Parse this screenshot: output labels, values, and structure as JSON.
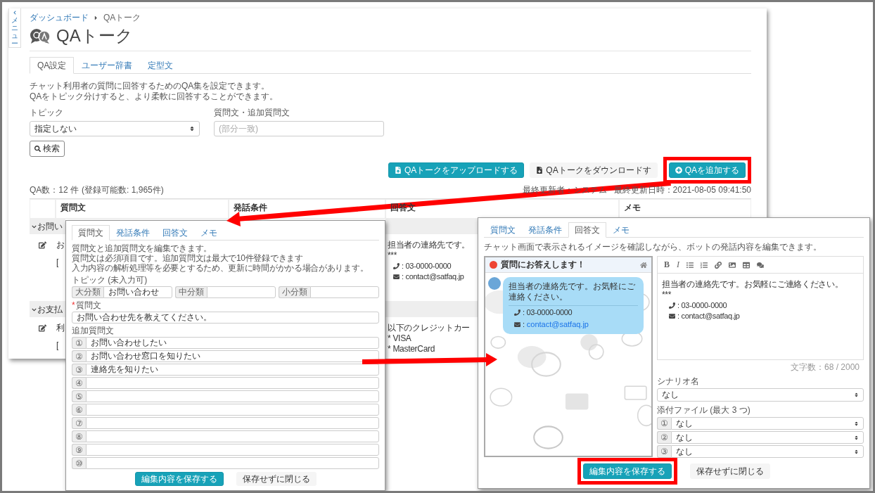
{
  "side_menu": {
    "label": "メニュー"
  },
  "breadcrumb": [
    "ダッシュボード",
    "QAトーク"
  ],
  "page_title": "QAトーク",
  "tabs": [
    {
      "label": "QA設定",
      "selected": true
    },
    {
      "label": "ユーザー辞書",
      "selected": false
    },
    {
      "label": "定型文",
      "selected": false
    }
  ],
  "description": [
    "チャット利用者の質問に回答するためのQA集を設定できます。",
    "QAをトピック分けすると、より柔軟に回答することができます。"
  ],
  "filters": {
    "topic": {
      "label": "トピック",
      "value": "指定しない"
    },
    "query": {
      "label": "質問文・追加質問文",
      "placeholder": "(部分一致)"
    },
    "search_button": "検索"
  },
  "actions": [
    {
      "kind": "upload",
      "label": "QAトークをアップロードする",
      "highlighted": false
    },
    {
      "kind": "download",
      "label": "QAトークをダウンロードす",
      "highlighted": false
    },
    {
      "kind": "add",
      "label": "QAを追加する",
      "highlighted": true
    }
  ],
  "summary": {
    "count": "QA数：12 件",
    "capacity": "(登録可能数: 1,965件)",
    "updated_by": "最終更新者：システム",
    "updated_at": "最終更新日時：2021-08-05 09:41:50"
  },
  "table": {
    "columns": [
      "質問文",
      "発話条件",
      "回答文",
      "メモ"
    ],
    "groups": [
      {
        "label": "お問い",
        "expanded": true,
        "rows": [
          {
            "question": [
              "お",
              "["
            ],
            "answer": [
              {
                "kind": "text",
                "text": "担当者の連絡先です。"
              },
              {
                "kind": "text",
                "text": "***"
              },
              {
                "kind": "phone",
                "label": ":",
                "text": "03-0000-0000",
                "link": false
              },
              {
                "kind": "email",
                "label": ":",
                "text": "contact@satfaq.jp",
                "link": false
              }
            ]
          }
        ]
      },
      {
        "label": "お支払",
        "expanded": true,
        "rows": [
          {
            "question": [
              "利",
              "["
            ],
            "answer": [
              {
                "kind": "text",
                "text": "以下のクレジットカー"
              },
              {
                "kind": "text",
                "text": "* VISA"
              },
              {
                "kind": "text",
                "text": "* MasterCard"
              }
            ]
          }
        ]
      }
    ]
  },
  "question_editor": {
    "tabs": [
      {
        "label": "質問文",
        "selected": true
      },
      {
        "label": "発話条件",
        "selected": false
      },
      {
        "label": "回答文",
        "selected": false
      },
      {
        "label": "メモ",
        "selected": false
      }
    ],
    "description": [
      "質問文と追加質問文を編集できます。",
      "質問文は必須項目です。追加質問文は最大で10件登録できます",
      "入力内容の解析処理等を必要とするため、更新に時間がかかる場合があります。"
    ],
    "topic_label": "トピック (未入力可)",
    "topic_fields": [
      {
        "label": "大分類",
        "value": "お問い合わせ"
      },
      {
        "label": "中分類"
      },
      {
        "label": "小分類"
      }
    ],
    "required_mark": "*",
    "question_label": "質問文",
    "question": "お問い合わせ先を教えてください。",
    "extra_label": "追加質問文",
    "extra_questions": [
      {
        "number": "①",
        "value": "お問い合わせしたい"
      },
      {
        "number": "②",
        "value": "お問い合わせ窓口を知りたい"
      },
      {
        "number": "③",
        "value": "連絡先を知りたい"
      },
      {
        "number": "④"
      },
      {
        "number": "⑤"
      },
      {
        "number": "⑥"
      },
      {
        "number": "⑦"
      },
      {
        "number": "⑧"
      },
      {
        "number": "⑨"
      },
      {
        "number": "⑩"
      }
    ],
    "buttons": [
      {
        "kind": "primary",
        "label": "編集内容を保存する",
        "highlighted": false
      },
      {
        "kind": "plain",
        "label": "保存せずに閉じる",
        "highlighted": false
      }
    ]
  },
  "answer_editor": {
    "tabs": [
      {
        "label": "質問文",
        "selected": false
      },
      {
        "label": "発話条件",
        "selected": false
      },
      {
        "label": "回答文",
        "selected": true
      },
      {
        "label": "メモ",
        "selected": false
      }
    ],
    "description": "チャット画面で表示されるイメージを確認しながら、ボットの発話内容を編集できます。",
    "preview": {
      "title": "質問にお答えします！",
      "message": "担当者の連絡先です。お気軽にご連絡ください。",
      "contacts": [
        {
          "kind": "phone",
          "label": ":",
          "text": "03-0000-0000",
          "link": false
        },
        {
          "kind": "email",
          "label": ":",
          "text": "contact@satfaq.jp",
          "link": true
        }
      ]
    },
    "editor": {
      "toolbar": [
        {
          "kind": "bold",
          "label": "B"
        },
        {
          "kind": "italic",
          "label": "I"
        },
        {
          "kind": "bullets"
        },
        {
          "kind": "numbers"
        },
        {
          "kind": "link"
        },
        {
          "kind": "image"
        },
        {
          "kind": "table"
        },
        {
          "kind": "comment"
        }
      ],
      "lines": [
        {
          "kind": "text",
          "text": "担当者の連絡先です。お気軽にご連絡ください。"
        },
        {
          "kind": "text",
          "text": "***"
        },
        {
          "kind": "phone",
          "label": ":",
          "text": "03-0000-0000",
          "link": false
        },
        {
          "kind": "email",
          "label": ":",
          "text": "contact@satfaq.jp",
          "link": false
        }
      ],
      "char_count": "文字数：68 / 2000"
    },
    "scenario": {
      "label": "シナリオ名",
      "value": "なし"
    },
    "attachments": {
      "label": "添付ファイル (最大 3 つ)",
      "items": [
        {
          "number": "①",
          "value": "なし"
        },
        {
          "number": "②",
          "value": "なし"
        },
        {
          "number": "③",
          "value": "なし"
        }
      ]
    },
    "buttons": [
      {
        "kind": "primary",
        "label": "編集内容を保存する",
        "highlighted": true
      },
      {
        "kind": "plain",
        "label": "保存せずに閉じる",
        "highlighted": false
      }
    ]
  }
}
